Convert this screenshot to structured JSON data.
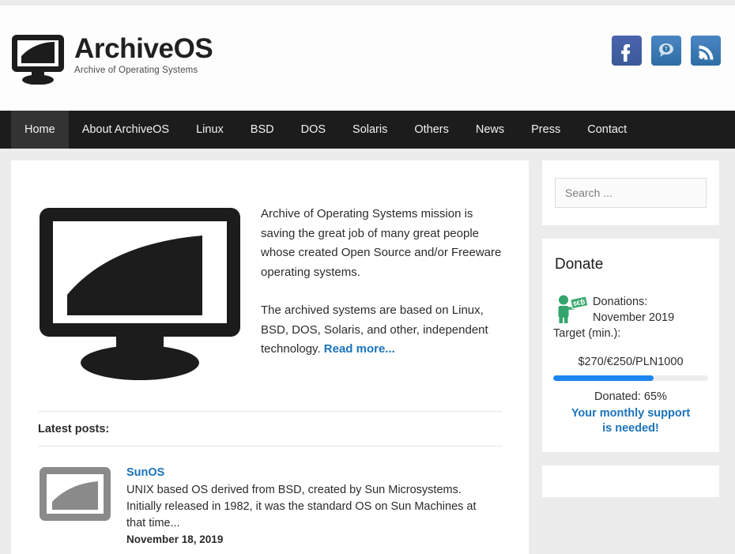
{
  "site": {
    "logo_title": "ArchiveOS",
    "logo_subtitle": "Archive of Operating Systems",
    "logo_icon": "monitor-icon"
  },
  "social": [
    {
      "name": "facebook-icon",
      "label": "f",
      "color": "#3b5998"
    },
    {
      "name": "twitter-icon",
      "label": "t",
      "color": "#2e6da4"
    },
    {
      "name": "rss-icon",
      "label": "rss",
      "color": "#2e6da4"
    }
  ],
  "nav": {
    "items": [
      {
        "label": "Home",
        "active": true
      },
      {
        "label": "About ArchiveOS",
        "active": false
      },
      {
        "label": "Linux",
        "active": false
      },
      {
        "label": "BSD",
        "active": false
      },
      {
        "label": "DOS",
        "active": false
      },
      {
        "label": "Solaris",
        "active": false
      },
      {
        "label": "Others",
        "active": false
      },
      {
        "label": "News",
        "active": false
      },
      {
        "label": "Press",
        "active": false
      },
      {
        "label": "Contact",
        "active": false
      }
    ]
  },
  "main": {
    "intro_paragraph_1": "Archive of Operating Systems mission is saving the great job of many great people whose created Open Source and/or Freeware operating systems.",
    "intro_paragraph_2": "The archived systems are based on Linux, BSD, DOS, Solaris, and other, independent technology. ",
    "read_more": "Read more...",
    "latest_posts_label": "Latest posts:",
    "posts": [
      {
        "title": "SunOS",
        "excerpt": "UNIX based OS derived from BSD, created by Sun Microsystems. Initially released in 1982, it was the standard OS on Sun Machines at that time...",
        "date": "November 18, 2019",
        "thumb_icon": "monitor-thumbnail-icon"
      }
    ]
  },
  "sidebar": {
    "search": {
      "placeholder": "Search ...",
      "value": ""
    },
    "donate": {
      "title": "Donate",
      "icon": "person-with-money-icon",
      "line_1": "Donations:",
      "line_2": "November 2019",
      "line_3": "Target (min.):",
      "amount": "$270/€250/PLN1000",
      "progress_percent": 65,
      "donated_label": "Donated: 65%",
      "support_line_1": "Your monthly support",
      "support_line_2": "is needed!",
      "progress_color": "#1b86f0",
      "link_color": "#1a73bb"
    }
  }
}
